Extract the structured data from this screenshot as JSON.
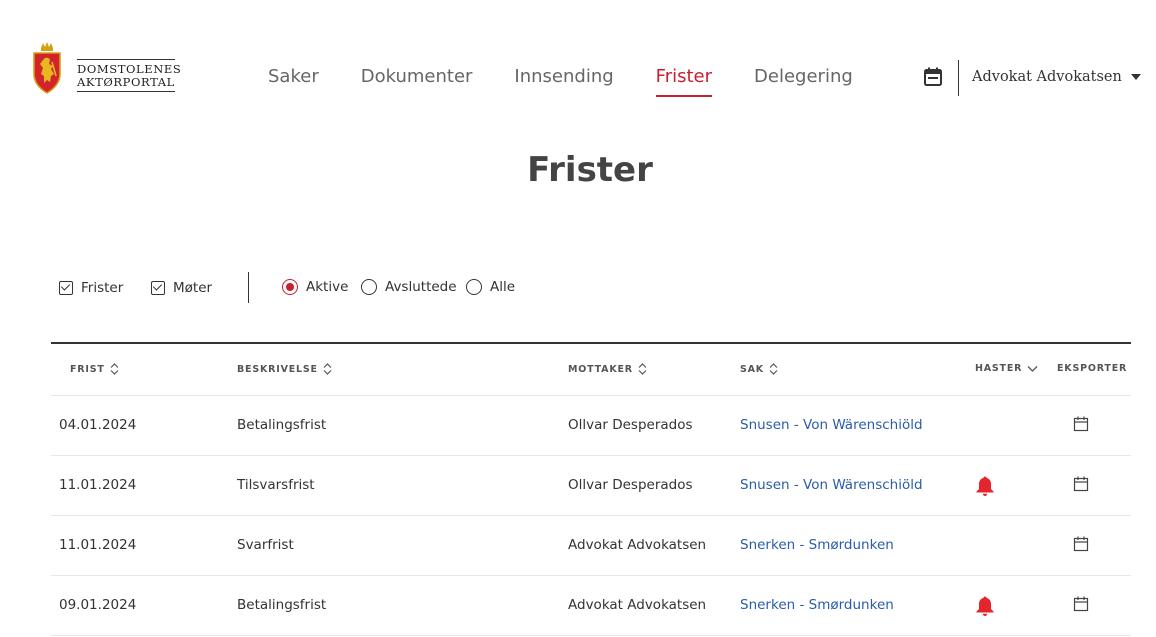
{
  "header": {
    "logo_line1": "DOMSTOLENES",
    "logo_line2": "AKTØRPORTAL",
    "nav": [
      {
        "label": "Saker",
        "active": false
      },
      {
        "label": "Dokumenter",
        "active": false
      },
      {
        "label": "Innsending",
        "active": false
      },
      {
        "label": "Frister",
        "active": true
      },
      {
        "label": "Delegering",
        "active": false
      }
    ],
    "user_name": "Advokat Advokatsen"
  },
  "page": {
    "title": "Frister"
  },
  "filters": {
    "checkboxes": [
      {
        "label": "Frister",
        "checked": true
      },
      {
        "label": "Møter",
        "checked": true
      }
    ],
    "radios": [
      {
        "label": "Aktive",
        "checked": true
      },
      {
        "label": "Avsluttede",
        "checked": false
      },
      {
        "label": "Alle",
        "checked": false
      }
    ]
  },
  "table": {
    "columns": {
      "frist": "FRIST",
      "beskrivelse": "BESKRIVELSE",
      "mottaker": "MOTTAKER",
      "sak": "SAK",
      "haster": "HASTER",
      "eksporter": "EKSPORTER"
    },
    "rows": [
      {
        "frist": "04.01.2024",
        "beskrivelse": "Betalingsfrist",
        "mottaker": "Ollvar Desperados",
        "sak": "Snusen - Von Wärenschiöld",
        "haster": false
      },
      {
        "frist": "11.01.2024",
        "beskrivelse": "Tilsvarsfrist",
        "mottaker": "Ollvar Desperados",
        "sak": "Snusen - Von Wärenschiöld",
        "haster": true
      },
      {
        "frist": "11.01.2024",
        "beskrivelse": "Svarfrist",
        "mottaker": "Advokat Advokatsen",
        "sak": "Snerken - Smørdunken",
        "haster": false
      },
      {
        "frist": "09.01.2024",
        "beskrivelse": "Betalingsfrist",
        "mottaker": "Advokat Advokatsen",
        "sak": "Snerken - Smørdunken",
        "haster": true
      }
    ]
  },
  "colors": {
    "accent": "#c8202e",
    "link": "#2a5ca8",
    "bell": "#e4252b"
  }
}
